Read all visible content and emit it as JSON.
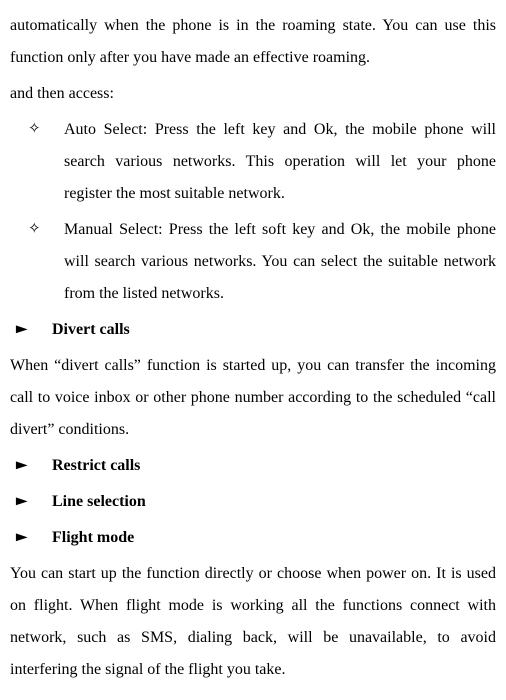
{
  "intro_p1": "automatically when the phone is in the roaming state. You can use this function only after you have made an effective roaming.",
  "intro_p2": "and then access:",
  "bullets": {
    "auto": "Auto Select: Press the left key and Ok, the mobile phone will search various networks. This operation will let your phone register the most suitable network.",
    "manual": "Manual Select: Press the left soft key and Ok, the mobile phone will search various networks. You can select the suitable network from the listed networks."
  },
  "sections": {
    "divert": "Divert calls",
    "divert_body": "When “divert calls” function is started up, you can transfer the incoming call to voice inbox or other phone number according to the scheduled “call divert” conditions.",
    "restrict": "Restrict calls",
    "line": "Line selection",
    "flight": "Flight mode",
    "flight_body": "You can start up the function directly or choose when power on. It is used on flight. When flight mode is working all the functions connect with network, such as SMS, dialing back, will be unavailable, to avoid interfering the signal of the flight you take."
  }
}
